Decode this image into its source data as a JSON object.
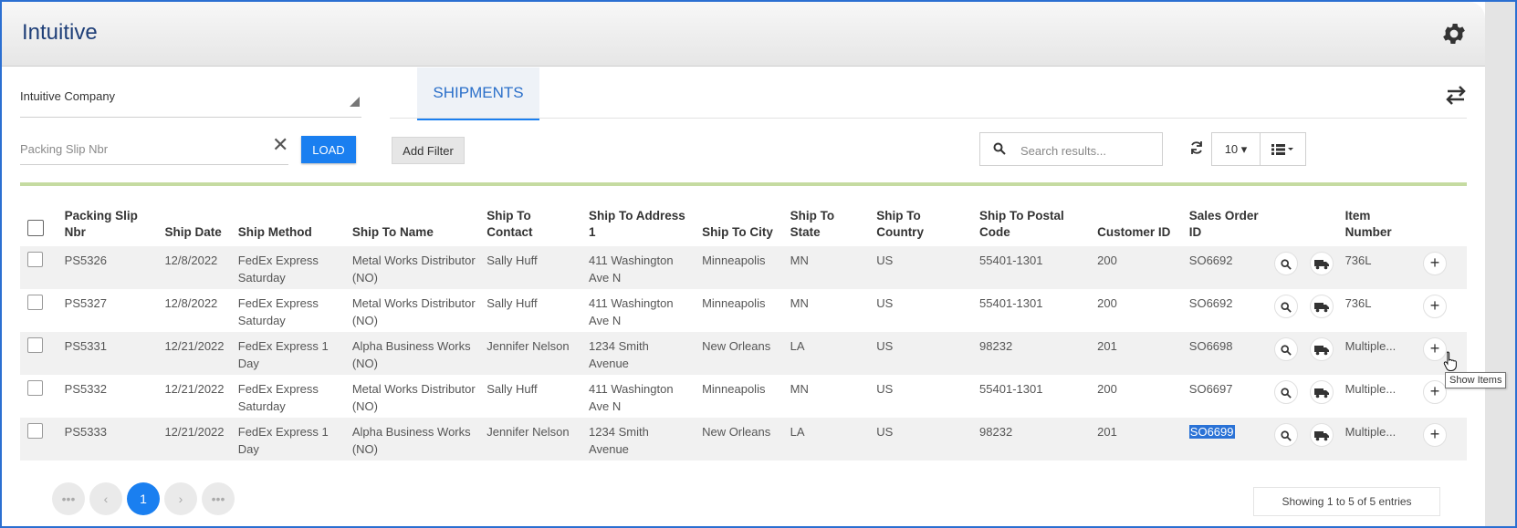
{
  "app": {
    "title": "Intuitive"
  },
  "company": {
    "value": "Intuitive Company"
  },
  "packing_slip": {
    "placeholder": "Packing Slip Nbr",
    "clear_label": "✕"
  },
  "load_button": "LOAD",
  "tabs": [
    {
      "label": "SHIPMENTS",
      "active": true
    }
  ],
  "toolbar": {
    "add_filter": "Add Filter",
    "search_placeholder": "Search results...",
    "page_size": "10 ▾"
  },
  "table": {
    "columns": [
      "Packing Slip Nbr",
      "Ship Date",
      "Ship Method",
      "Ship To Name",
      "Ship To Contact",
      "Ship To Address 1",
      "Ship To City",
      "Ship To State",
      "Ship To Country",
      "Ship To Postal Code",
      "Customer ID",
      "Sales Order ID",
      "Item Number"
    ],
    "rows": [
      {
        "packing_slip": "PS5326",
        "ship_date": "12/8/2022",
        "ship_method": "FedEx Express Saturday",
        "ship_to_name": "Metal Works Distributor (NO)",
        "contact": "Sally Huff",
        "address": "411 Washington Ave N",
        "city": "Minneapolis",
        "state": "MN",
        "country": "US",
        "postal": "55401-1301",
        "customer_id": "200",
        "sales_order": "SO6692",
        "item": "736L"
      },
      {
        "packing_slip": "PS5327",
        "ship_date": "12/8/2022",
        "ship_method": "FedEx Express Saturday",
        "ship_to_name": "Metal Works Distributor (NO)",
        "contact": "Sally Huff",
        "address": "411 Washington Ave N",
        "city": "Minneapolis",
        "state": "MN",
        "country": "US",
        "postal": "55401-1301",
        "customer_id": "200",
        "sales_order": "SO6692",
        "item": "736L"
      },
      {
        "packing_slip": "PS5331",
        "ship_date": "12/21/2022",
        "ship_method": "FedEx Express 1 Day",
        "ship_to_name": "Alpha Business Works (NO)",
        "contact": "Jennifer Nelson",
        "address": "1234 Smith Avenue",
        "city": "New Orleans",
        "state": "LA",
        "country": "US",
        "postal": "98232",
        "customer_id": "201",
        "sales_order": "SO6698",
        "item": "Multiple..."
      },
      {
        "packing_slip": "PS5332",
        "ship_date": "12/21/2022",
        "ship_method": "FedEx Express Saturday",
        "ship_to_name": "Metal Works Distributor (NO)",
        "contact": "Sally Huff",
        "address": "411 Washington Ave N",
        "city": "Minneapolis",
        "state": "MN",
        "country": "US",
        "postal": "55401-1301",
        "customer_id": "200",
        "sales_order": "SO6697",
        "item": "Multiple..."
      },
      {
        "packing_slip": "PS5333",
        "ship_date": "12/21/2022",
        "ship_method": "FedEx Express 1 Day",
        "ship_to_name": "Alpha Business Works (NO)",
        "contact": "Jennifer Nelson",
        "address": "1234 Smith Avenue",
        "city": "New Orleans",
        "state": "LA",
        "country": "US",
        "postal": "98232",
        "customer_id": "201",
        "sales_order": "SO6699",
        "item": "Multiple...",
        "sales_order_selected": true
      }
    ]
  },
  "tooltip": "Show Items",
  "pagination": {
    "first": "•••",
    "prev": "‹",
    "current": "1",
    "next": "›",
    "last": "•••"
  },
  "entries_text": "Showing 1 to 5 of 5 entries",
  "colors": {
    "accent": "#1a7ff0",
    "title": "#1f3f78",
    "tab_text": "#2a6fc9",
    "divider": "#c5dba1"
  },
  "icons": [
    "gear-icon",
    "swap-icon",
    "search-icon",
    "refresh-icon",
    "list-view-icon",
    "truck-icon",
    "plus-icon",
    "clear-icon"
  ]
}
